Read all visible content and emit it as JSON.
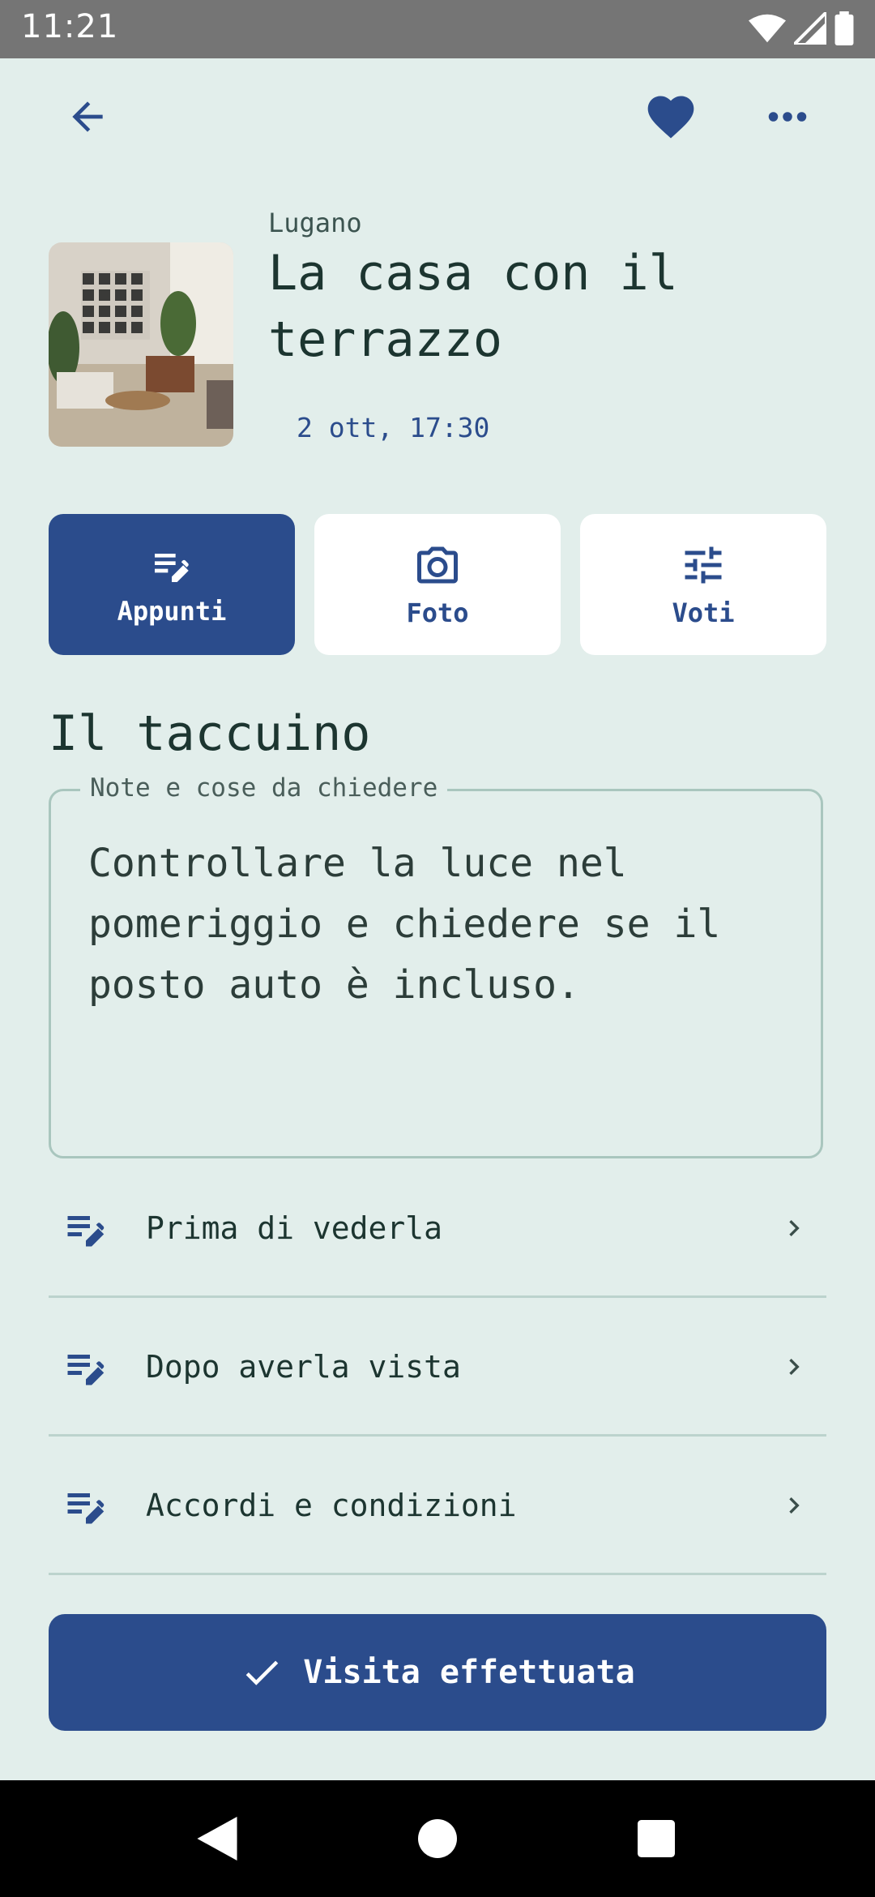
{
  "status_bar": {
    "time": "11:21"
  },
  "header": {
    "city": "Lugano",
    "title": "La casa con il terrazzo",
    "date": "2 ott, 17:30"
  },
  "tabs": [
    {
      "label": "Appunti",
      "icon": "edit-note-icon",
      "active": true
    },
    {
      "label": "Foto",
      "icon": "camera-icon",
      "active": false
    },
    {
      "label": "Voti",
      "icon": "tune-icon",
      "active": false
    }
  ],
  "notebook": {
    "title": "Il taccuino",
    "field_label": "Note e cose da chiedere",
    "field_value": "Controllare la luce nel pomeriggio e chiedere se il posto auto è incluso."
  },
  "sections": [
    {
      "label": "Prima di vederla",
      "icon": "edit-note-icon"
    },
    {
      "label": "Dopo averla vista",
      "icon": "edit-note-icon"
    },
    {
      "label": "Accordi e condizioni",
      "icon": "edit-note-icon"
    }
  ],
  "cta": {
    "label": "Visita effettuata",
    "icon": "check-icon"
  },
  "colors": {
    "background": "#e2eeeb",
    "accent": "#2b4c8c",
    "text": "#1c3530"
  }
}
